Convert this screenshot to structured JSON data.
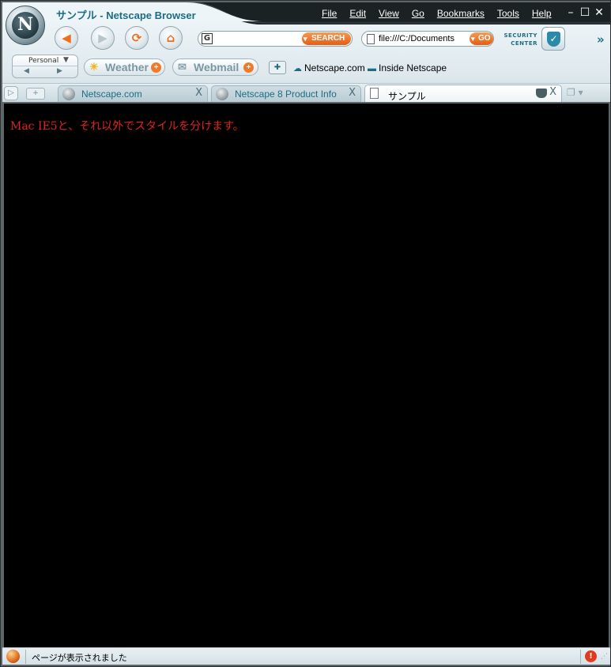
{
  "window": {
    "page_title": "サンプル",
    "title_separator": " - ",
    "app_name": "Netscape Browser",
    "logo_letter": "N"
  },
  "menu": {
    "items": [
      "File",
      "Edit",
      "View",
      "Go",
      "Bookmarks",
      "Tools",
      "Help"
    ]
  },
  "window_controls": {
    "minimize": "–",
    "maximize": "☐",
    "close": "✕"
  },
  "navigation": {
    "back_icon": "◀",
    "forward_icon": "▶",
    "reload_icon": "⟳",
    "home_icon": "⌂"
  },
  "search": {
    "engine_icon": "G",
    "value": "",
    "button_label": "SEARCH"
  },
  "address": {
    "value": "file:///C:/Documents",
    "go_label": "GO"
  },
  "security": {
    "label_line1": "SECURITY",
    "label_line2": "CENTER",
    "shield_glyph": "✓"
  },
  "more_chevron": "»",
  "personal": {
    "label": "Personal",
    "dropdown": "▼",
    "prev": "◀",
    "next": "▶"
  },
  "toolbar": {
    "weather_label": "Weather",
    "weather_icon": "☀",
    "webmail_label": "Webmail",
    "webmail_icon": "✉",
    "plus": "+",
    "add_bookmark_icon": "✚"
  },
  "bookmarks": {
    "items": [
      {
        "label": "Netscape.com",
        "icon": "☁"
      },
      {
        "label": "Inside Netscape",
        "icon": "▬"
      }
    ]
  },
  "tabs": {
    "scroll_icon": "▷",
    "new_tab_icon": "+",
    "close_glyph": "X",
    "list_icon": "❐ ▾",
    "items": [
      {
        "label": "Netscape.com",
        "active": false
      },
      {
        "label": "Netscape 8 Product Info",
        "active": false
      },
      {
        "label": "サンプル",
        "active": true
      }
    ]
  },
  "content": {
    "text": "Mac IE5と、それ以外でスタイルを分けます。",
    "text_color": "#e0231e",
    "background": "#000000"
  },
  "status": {
    "text": "ページが表示されました",
    "alert_glyph": "!",
    "grip": "⋰"
  },
  "colors": {
    "accent": "#1e6c84",
    "orange": "#e45d12"
  }
}
